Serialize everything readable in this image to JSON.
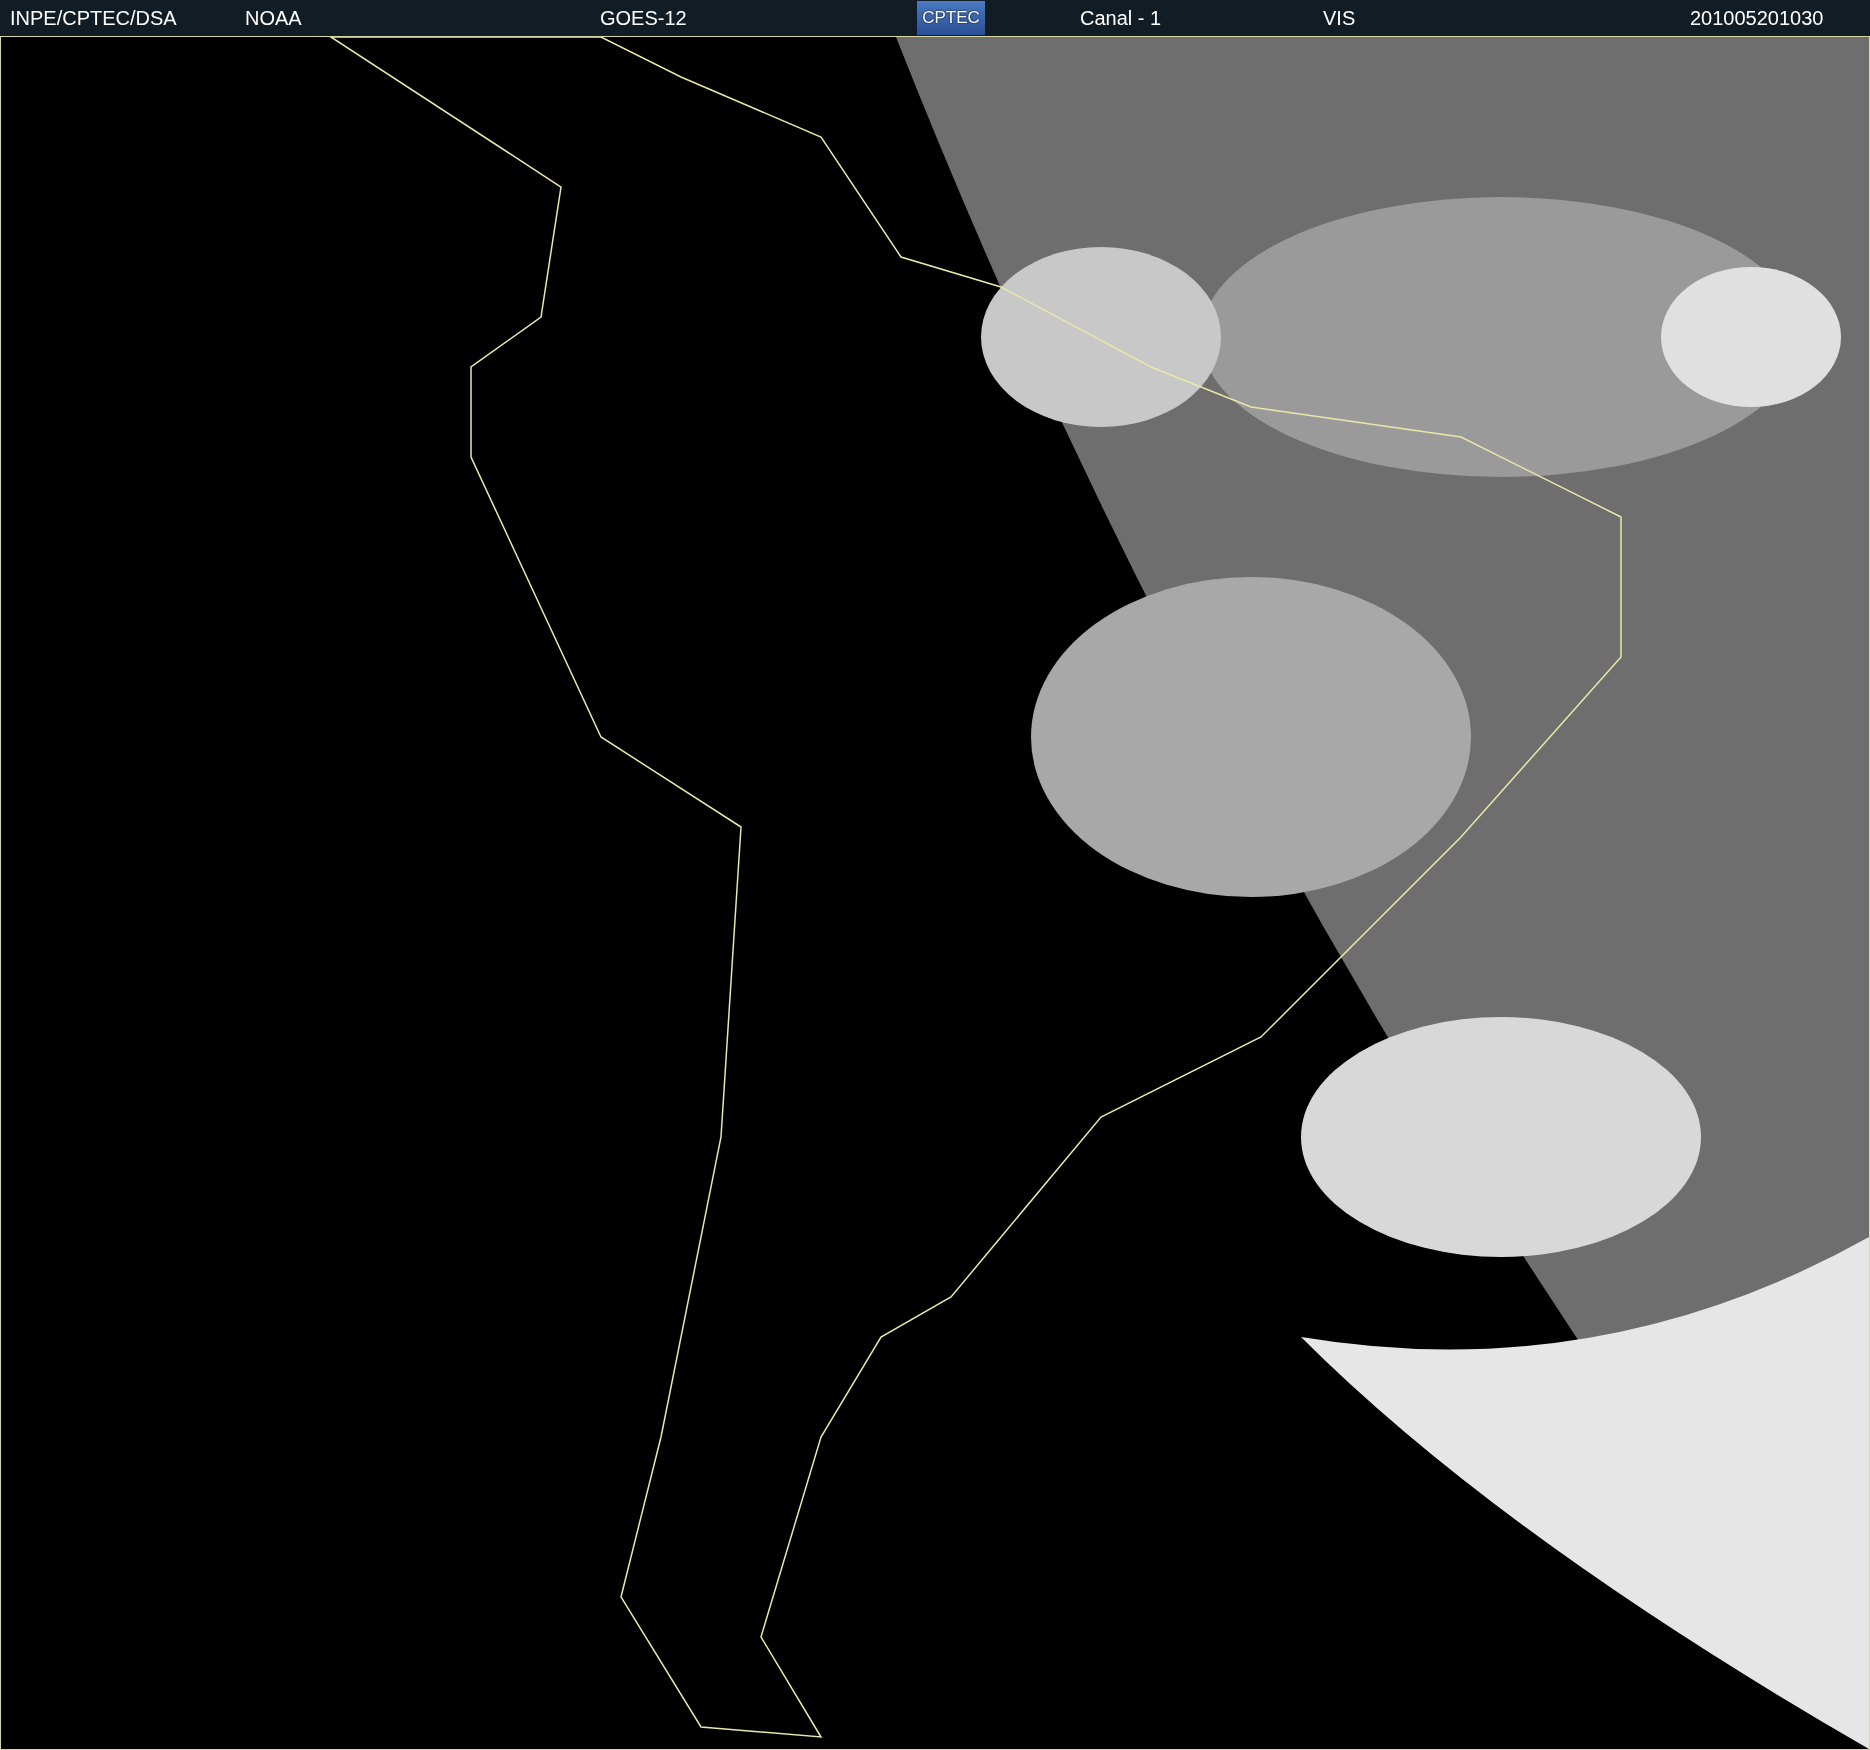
{
  "header": {
    "items": [
      {
        "kind": "text",
        "text": "INPE/CPTEC/DSA"
      },
      {
        "kind": "text",
        "text": "NOAA"
      },
      {
        "kind": "text",
        "text": "GOES-12"
      },
      {
        "kind": "logo",
        "text": "CPTEC"
      },
      {
        "kind": "text",
        "text": "Canal - 1"
      },
      {
        "kind": "text",
        "text": "VIS"
      },
      {
        "kind": "text",
        "text": "201005201030"
      }
    ]
  }
}
